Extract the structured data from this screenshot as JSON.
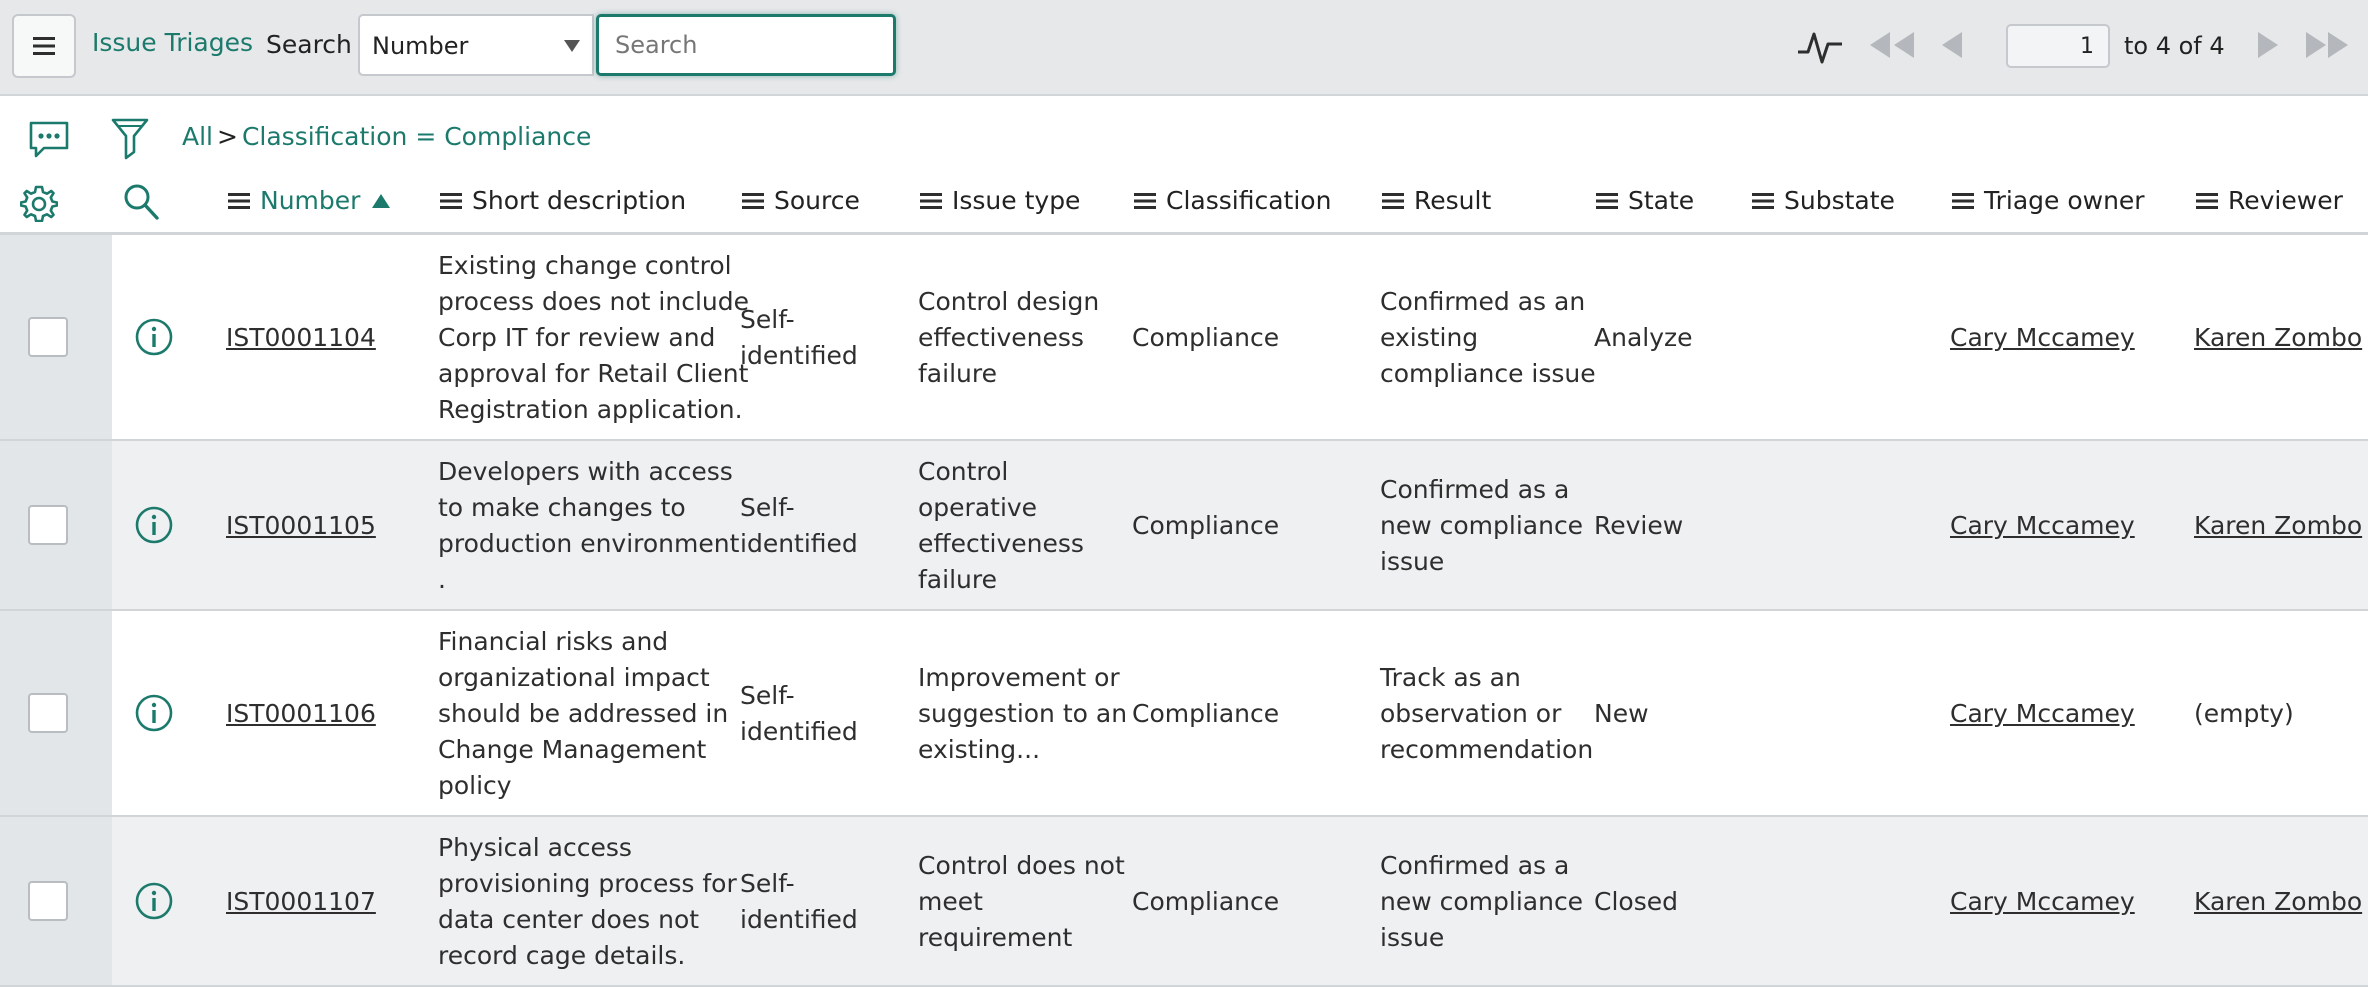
{
  "header": {
    "menu_icon": "hamburger-icon",
    "app_title": "Issue Triages",
    "search_label": "Search",
    "search_field_select": "Number",
    "search_placeholder": "Search",
    "activity_icon": "pulse-icon",
    "page_number": "1",
    "page_range": "to 4 of 4",
    "nav_icons": [
      "first-page-icon",
      "previous-page-icon",
      "next-page-icon",
      "last-page-icon"
    ]
  },
  "breadcrumb": {
    "all": "All",
    "separator": ">",
    "filter": "Classification = Compliance"
  },
  "columns": [
    {
      "label": "Number",
      "sorted": "ascending"
    },
    {
      "label": "Short description"
    },
    {
      "label": "Source"
    },
    {
      "label": "Issue type"
    },
    {
      "label": "Classification"
    },
    {
      "label": "Result"
    },
    {
      "label": "State"
    },
    {
      "label": "Substate"
    },
    {
      "label": "Triage owner"
    },
    {
      "label": "Reviewer"
    }
  ],
  "rows": [
    {
      "number": "IST0001104",
      "short_description": [
        "Existing change control",
        "process does not include",
        "Corp IT for review and",
        "approval for Retail Client",
        "Registration application."
      ],
      "source": [
        "Self-",
        "identified"
      ],
      "issue_type": [
        "Control design",
        "effectiveness",
        "failure"
      ],
      "classification": "Compliance",
      "result": [
        "Confirmed as an",
        "existing",
        "compliance issue"
      ],
      "state": "Analyze",
      "substate": "",
      "triage_owner": "Cary Mccamey",
      "reviewer": "Karen Zombo"
    },
    {
      "number": "IST0001105",
      "short_description": [
        "Developers with access",
        "to make changes to",
        "production environment",
        "."
      ],
      "source": [
        "Self-",
        "identified"
      ],
      "issue_type": [
        "Control",
        "operative",
        "effectiveness",
        "failure"
      ],
      "classification": "Compliance",
      "result": [
        "Confirmed as a",
        "new compliance",
        "issue"
      ],
      "state": "Review",
      "substate": "",
      "triage_owner": "Cary Mccamey",
      "reviewer": "Karen Zombo"
    },
    {
      "number": "IST0001106",
      "short_description": [
        "Financial risks and",
        "organizational impact",
        "should be addressed in",
        "Change Management",
        "policy"
      ],
      "source": [
        "Self-",
        "identified"
      ],
      "issue_type": [
        "Improvement or",
        "suggestion to an",
        "existing..."
      ],
      "classification": "Compliance",
      "result": [
        "Track as an",
        "observation or",
        "recommendation"
      ],
      "state": "New",
      "substate": "",
      "triage_owner": "Cary Mccamey",
      "reviewer": "(empty)"
    },
    {
      "number": "IST0001107",
      "short_description": [
        "Physical access",
        "provisioning process for",
        "data center does not",
        "record cage details."
      ],
      "source": [
        "Self-",
        "identified"
      ],
      "issue_type": [
        "Control does not",
        "meet",
        "requirement"
      ],
      "classification": "Compliance",
      "result": [
        "Confirmed as a",
        "new compliance",
        "issue"
      ],
      "state": "Closed",
      "substate": "",
      "triage_owner": "Cary Mccamey",
      "reviewer": "Karen Zombo"
    }
  ],
  "colors": {
    "accent": "#1c7a6c",
    "header_bg": "#e6e8ea",
    "row_alt_bg": "#eef0f1"
  }
}
